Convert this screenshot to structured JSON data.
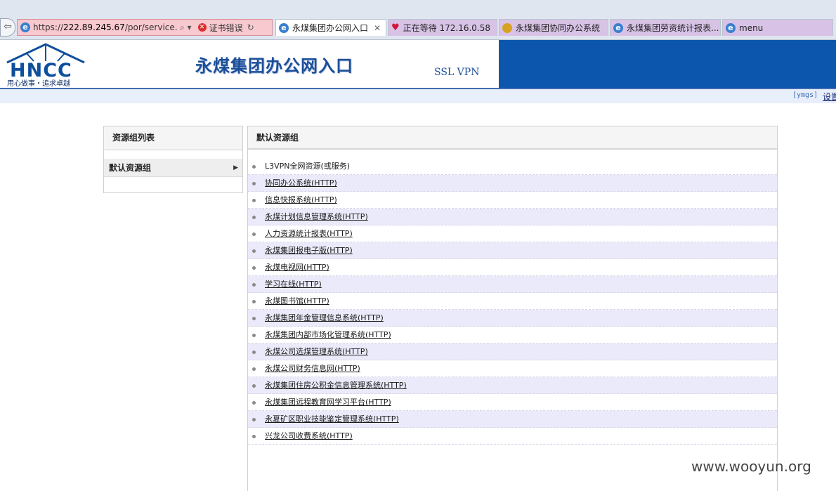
{
  "browser": {
    "address_url_prefix": "https://",
    "address_url_host": "222.89.245.67",
    "address_url_path": "/por/service.csp",
    "search_glyph": "⌕ ▾",
    "cert_error": "证书错误",
    "tabs": [
      {
        "label": "永煤集团办公网入口",
        "active": true,
        "close": "✕"
      },
      {
        "label": "正在等待 172.16.0.58",
        "active": false
      },
      {
        "label": "永煤集团协同办公系统",
        "active": false
      },
      {
        "label": "永煤集团劳资统计报表...",
        "active": false
      },
      {
        "label": "menu",
        "active": false
      }
    ]
  },
  "header": {
    "logo_letters": "HNCC",
    "logo_slogan": "用心做事・追求卓越",
    "title": "永煤集团办公网入口",
    "subtitle": "SSL VPN",
    "user_tag": "[ymgs]",
    "settings_link": "设置"
  },
  "sidebar": {
    "title": "资源组列表",
    "items": [
      {
        "label": "默认资源组",
        "selected": true
      }
    ]
  },
  "main": {
    "title": "默认资源组",
    "resources": [
      {
        "label": "L3VPN全网资源(或服务)",
        "link": false
      },
      {
        "label": "协同办公系统(HTTP)",
        "link": true
      },
      {
        "label": "信息快报系统(HTTP)",
        "link": true
      },
      {
        "label": "永煤计划信息管理系统(HTTP)",
        "link": true
      },
      {
        "label": "人力资源统计报表(HTTP)",
        "link": true
      },
      {
        "label": "永煤集团报电子版(HTTP)",
        "link": true
      },
      {
        "label": "永煤电视网(HTTP)",
        "link": true
      },
      {
        "label": "学习在线(HTTP)",
        "link": true
      },
      {
        "label": "永煤图书馆(HTTP)",
        "link": true
      },
      {
        "label": "永煤集团年金管理信息系统(HTTP)",
        "link": true
      },
      {
        "label": "永煤集团内部市场化管理系统(HTTP)",
        "link": true
      },
      {
        "label": "永煤公司选煤管理系统(HTTP)",
        "link": true
      },
      {
        "label": "永煤公司财务信息网(HTTP)",
        "link": true
      },
      {
        "label": "永煤集团住房公积金信息管理系统(HTTP)",
        "link": true
      },
      {
        "label": "永煤集团远程教育网学习平台(HTTP)",
        "link": true
      },
      {
        "label": "永夏矿区职业技能鉴定管理系统(HTTP)",
        "link": true
      },
      {
        "label": "兴龙公司收费系统(HTTP)",
        "link": true
      }
    ]
  },
  "watermark": "www.wooyun.org",
  "colors": {
    "banner_blue": "#0c57ad",
    "row_alt": "#eaeafa",
    "address_error": "#f8c9cf",
    "inactive_tab": "#d8c3e6"
  }
}
